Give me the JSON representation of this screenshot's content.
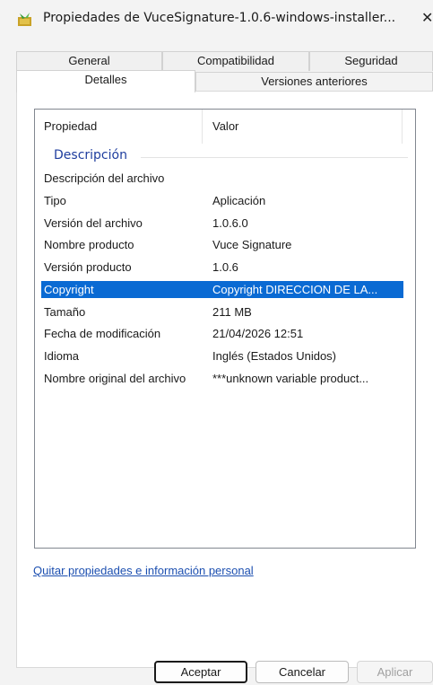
{
  "window": {
    "title": "Propiedades de VuceSignature-1.0.6-windows-installer...",
    "close_glyph": "✕"
  },
  "tabs": {
    "row_back": [
      "General",
      "Compatibilidad",
      "Seguridad"
    ],
    "row_front": [
      "Detalles",
      "Versiones anteriores"
    ],
    "active": "Detalles"
  },
  "details": {
    "columns": [
      "Propiedad",
      "Valor"
    ],
    "group": "Descripción",
    "rows": [
      {
        "property": "Descripción del archivo",
        "value": ""
      },
      {
        "property": "Tipo",
        "value": "Aplicación"
      },
      {
        "property": "Versión del archivo",
        "value": "1.0.6.0"
      },
      {
        "property": "Nombre producto",
        "value": "Vuce Signature"
      },
      {
        "property": "Versión producto",
        "value": "1.0.6"
      },
      {
        "property": "Copyright",
        "value": "Copyright DIRECCION DE LA..."
      },
      {
        "property": "Tamaño",
        "value": "211 MB"
      },
      {
        "property": "Fecha de modificación",
        "value": "21/04/2026 12:51"
      },
      {
        "property": "Idioma",
        "value": "Inglés (Estados Unidos)"
      },
      {
        "property": "Nombre original del archivo",
        "value": "***unknown variable product..."
      }
    ],
    "selected_row": "Copyright"
  },
  "link_text": "Quitar propiedades e información personal",
  "buttons": {
    "ok": "Aceptar",
    "cancel": "Cancelar",
    "apply": "Aplicar"
  },
  "colors": {
    "selection": "#0a6ad3",
    "group_label": "#1e3d9e",
    "link": "#1c4fb0"
  }
}
